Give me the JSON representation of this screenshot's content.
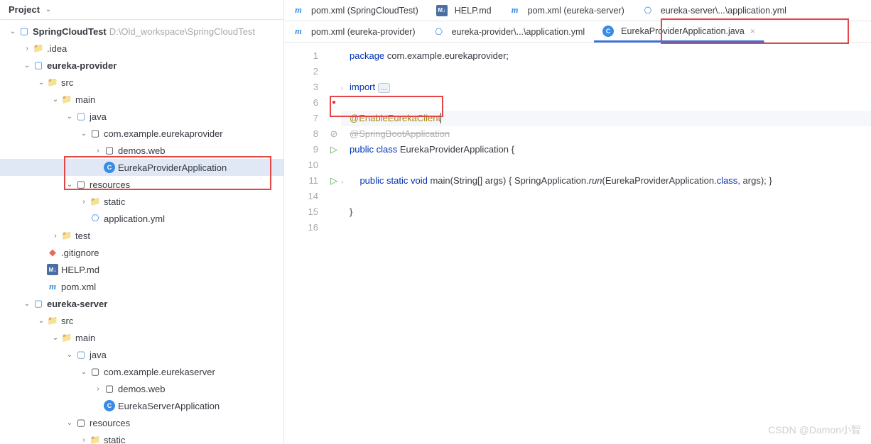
{
  "panel": {
    "title": "Project"
  },
  "project": {
    "name": "SpringCloudTest",
    "path": "D:\\Old_workspace\\SpringCloudTest"
  },
  "tree": {
    "idea": ".idea",
    "provider": "eureka-provider",
    "src": "src",
    "main": "main",
    "java": "java",
    "pkg_provider": "com.example.eurekaprovider",
    "demos_web": "demos.web",
    "provider_app": "EurekaProviderApplication",
    "resources": "resources",
    "static": "static",
    "app_yml": "application.yml",
    "test": "test",
    "gitignore": ".gitignore",
    "help": "HELP.md",
    "pom": "pom.xml",
    "server": "eureka-server",
    "pkg_server": "com.example.eurekaserver",
    "server_app": "EurekaServerApplication"
  },
  "tabs_row1": [
    {
      "icon": "maven",
      "label": "pom.xml (SpringCloudTest)"
    },
    {
      "icon": "md",
      "label": "HELP.md"
    },
    {
      "icon": "maven",
      "label": "pom.xml (eureka-server)"
    },
    {
      "icon": "yml",
      "label": "eureka-server\\...\\application.yml"
    }
  ],
  "tabs_row2": [
    {
      "icon": "maven",
      "label": "pom.xml (eureka-provider)"
    },
    {
      "icon": "yml",
      "label": "eureka-provider\\...\\application.yml"
    },
    {
      "icon": "class",
      "label": "EurekaProviderApplication.java",
      "active": true
    }
  ],
  "code": {
    "line1_kw": "package",
    "line1_pkg": " com.example.eurekaprovider;",
    "line3_kw": "import",
    "line3_rest": " ",
    "line7": "@EnableEurekaClient",
    "line8": "@SpringBootApplication",
    "line9_kw": "public class",
    "line9_cls": " EurekaProviderApplication {",
    "line11_kw": "public static void",
    "line11_m": " main",
    "line11_p": "(String[] args) { SpringApplication.",
    "line11_r": "run",
    "line11_a": "(EurekaProviderApplication.",
    "line11_c": "class",
    "line11_e": ", args); }",
    "line13": "}"
  },
  "line_numbers": [
    "1",
    "2",
    "3",
    "6",
    "7",
    "8",
    "9",
    "10",
    "11",
    "14",
    "15",
    "16"
  ],
  "watermark": "CSDN @Damon小智"
}
